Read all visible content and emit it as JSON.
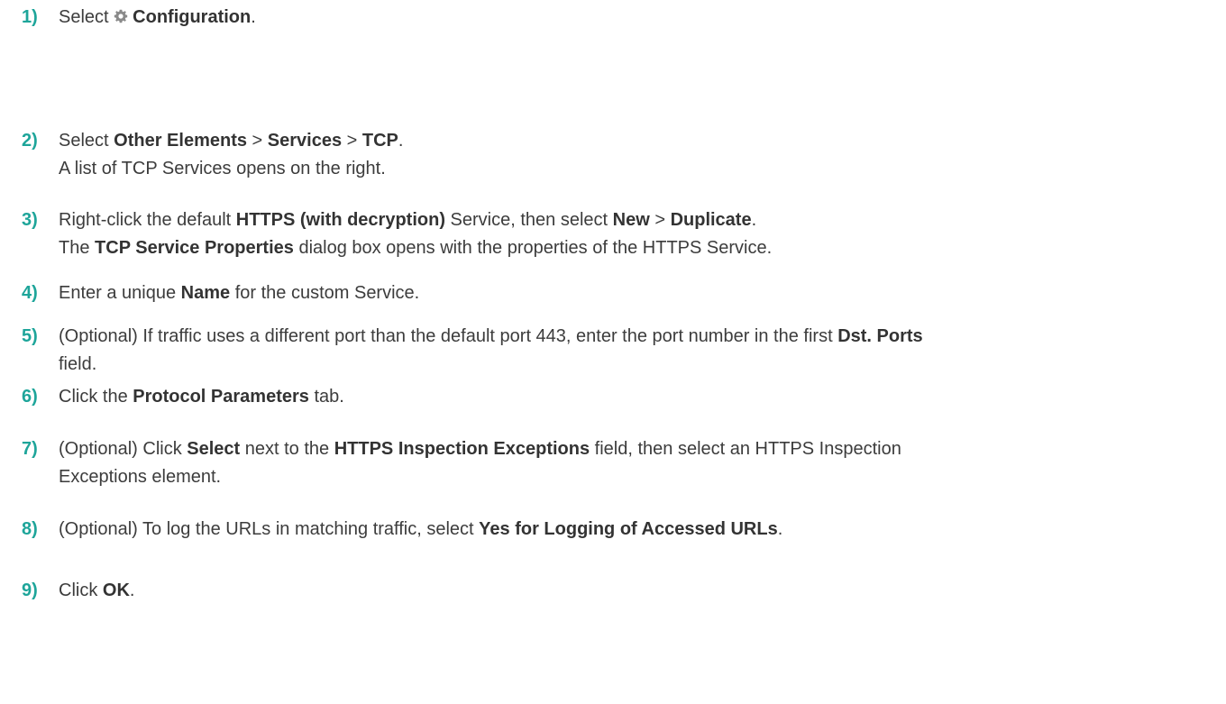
{
  "steps": [
    {
      "num": "1)",
      "lines": [
        {
          "a": "Select ",
          "icon": "gear-icon",
          "b1": "Configuration",
          "c": "."
        }
      ]
    },
    {
      "num": "2)",
      "lines": [
        {
          "a": "Select ",
          "b1": "Other Elements",
          "sep1": " > ",
          "b2": "Services",
          "sep2": " > ",
          "b3": "TCP",
          "c": "."
        },
        {
          "a": "A list of TCP Services opens on the right."
        }
      ]
    },
    {
      "num": "3)",
      "lines": [
        {
          "a": "Right-click the default ",
          "b1": "HTTPS (with decryption)",
          "m1": " Service, then select ",
          "b2": "New",
          "sep": " > ",
          "b3": "Duplicate",
          "c": "."
        },
        {
          "a": "The ",
          "b1": "TCP Service Properties",
          "c": " dialog box opens with the properties of the HTTPS Service."
        }
      ]
    },
    {
      "num": "4)",
      "lines": [
        {
          "a": "Enter a unique ",
          "b1": "Name",
          "c": " for the custom Service."
        }
      ]
    },
    {
      "num": "5)",
      "lines": [
        {
          "a": "(Optional) If traffic uses a different port than the default port 443, enter the port number in the first ",
          "b1": "Dst. Ports"
        },
        {
          "a": "field."
        }
      ]
    },
    {
      "num": "6)",
      "lines": [
        {
          "a": "Click the ",
          "b1": "Protocol Parameters",
          "c": " tab."
        }
      ]
    },
    {
      "num": "7)",
      "lines": [
        {
          "a": "(Optional) Click ",
          "b1": "Select",
          "m1": " next to the ",
          "b2": "HTTPS Inspection Exceptions",
          "c": " field, then select an HTTPS Inspection"
        },
        {
          "a": "Exceptions element."
        }
      ]
    },
    {
      "num": "8)",
      "lines": [
        {
          "a": "(Optional) To log the URLs in matching traffic, select ",
          "b1": "Yes for Logging of Accessed URLs",
          "c": "."
        }
      ]
    },
    {
      "num": "9)",
      "lines": [
        {
          "a": "Click ",
          "b1": "OK",
          "c": "."
        }
      ]
    }
  ],
  "colors": {
    "step_number": "#1ea59a",
    "text": "#3c3c3c",
    "icon": "#8a8a8a"
  }
}
